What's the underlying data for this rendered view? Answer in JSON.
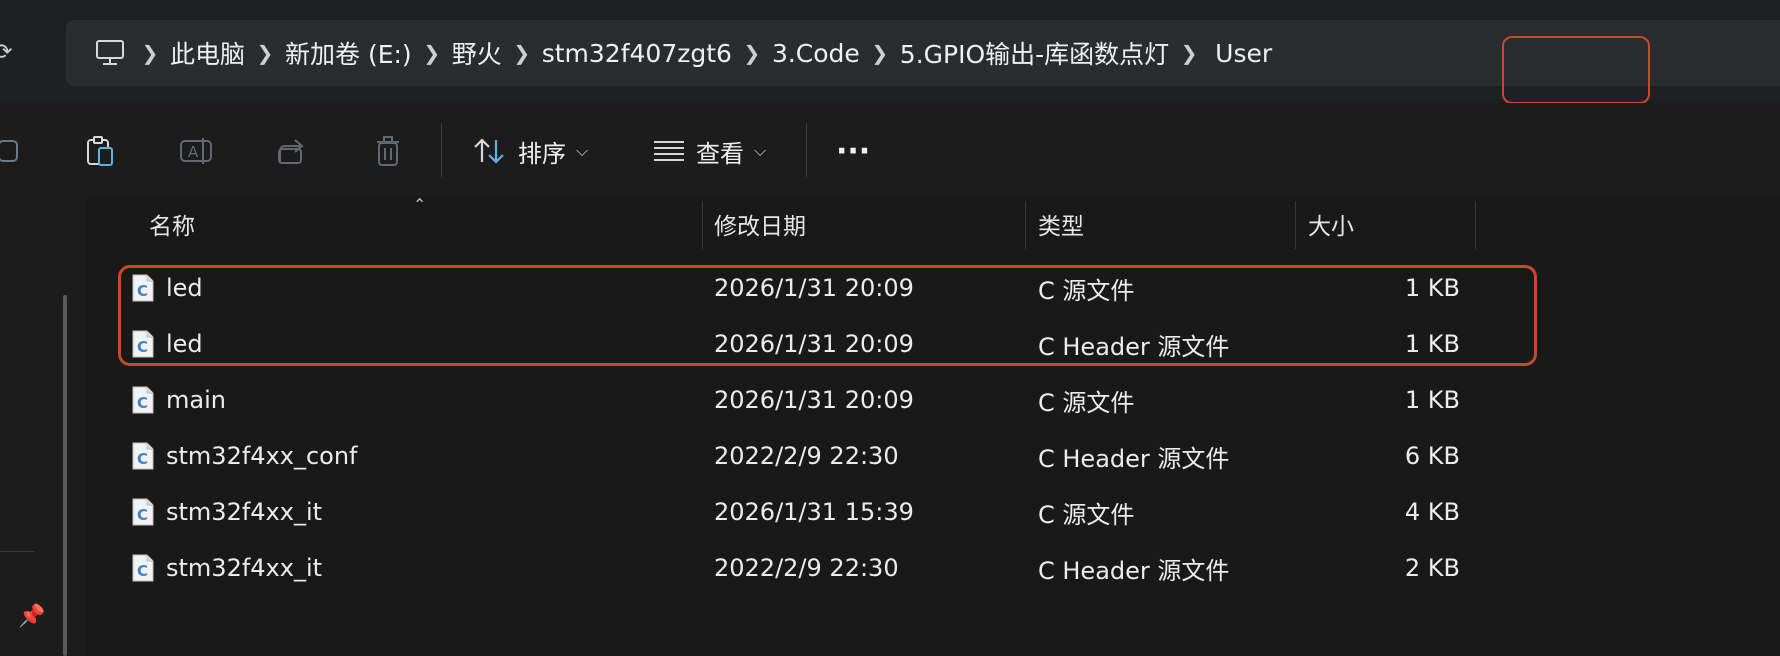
{
  "address": {
    "breadcrumbs": [
      "此电脑",
      "新加卷 (E:)",
      "野火",
      "stm32f407zgt6",
      "3.Code",
      "5.GPIO输出-库函数点灯",
      "User"
    ],
    "pc_icon": "computer-icon",
    "refresh_icon": "refresh-icon"
  },
  "toolbar": {
    "sort_label": "排序",
    "view_label": "查看",
    "more_label": "···"
  },
  "columns": {
    "name": "名称",
    "modified": "修改日期",
    "type": "类型",
    "size": "大小"
  },
  "files": [
    {
      "name": "led",
      "modified": "2026/1/31 20:09",
      "type": "C 源文件",
      "size": "1 KB"
    },
    {
      "name": "led",
      "modified": "2026/1/31 20:09",
      "type": "C Header 源文件",
      "size": "1 KB"
    },
    {
      "name": "main",
      "modified": "2026/1/31 20:09",
      "type": "C 源文件",
      "size": "1 KB"
    },
    {
      "name": "stm32f4xx_conf",
      "modified": "2022/2/9 22:30",
      "type": "C Header 源文件",
      "size": "6 KB"
    },
    {
      "name": "stm32f4xx_it",
      "modified": "2026/1/31 15:39",
      "type": "C 源文件",
      "size": "4 KB"
    },
    {
      "name": "stm32f4xx_it",
      "modified": "2022/2/9 22:30",
      "type": "C Header 源文件",
      "size": "2 KB"
    }
  ],
  "colors": {
    "highlight": "#c94a2b",
    "background": "#191919"
  }
}
